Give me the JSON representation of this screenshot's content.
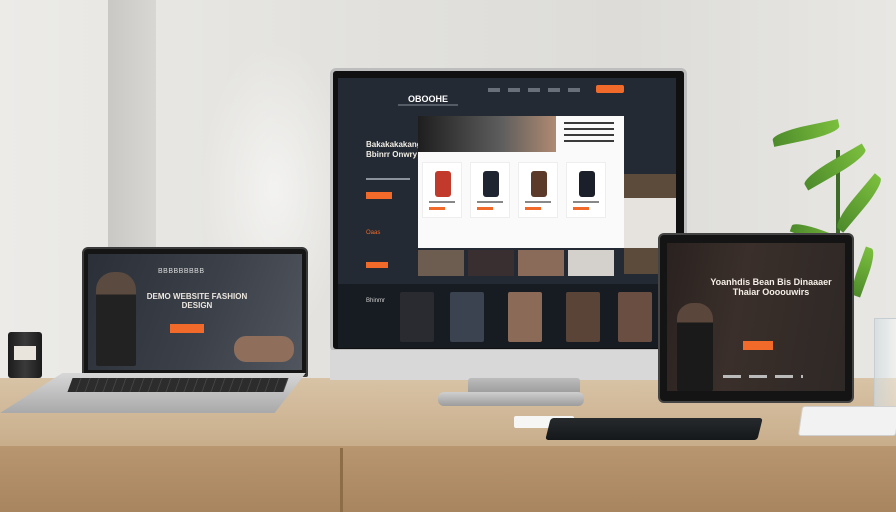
{
  "scene": {
    "description_free": true
  },
  "laptop": {
    "logo": "BBBBBBBBB",
    "headline": "DEMO WEBSITE FASHION DESIGN",
    "cta": ""
  },
  "monitor": {
    "logo": "OBOOHE",
    "hero_text": "Bakakakakang Bbinrr Onwry",
    "section_label": "Oaas",
    "strip_label": "Bhinmr",
    "products": [
      {
        "color": "#c23a2b"
      },
      {
        "color": "#1e2430"
      },
      {
        "color": "#5b3a2a"
      },
      {
        "color": "#1a1f2a"
      }
    ],
    "thumbs": [
      "#6d5d50",
      "#3a2f30",
      "#8a6b5a",
      "#d4d0cc"
    ],
    "strip_tiles": [
      "#2a2b30",
      "#3b4250",
      "#8b6a58",
      "#5a4438",
      "#4a3a33",
      "#6b4e42"
    ]
  },
  "tablet": {
    "headline": "Yoanhdis Bean Bis Dinaaaer Thaiar Oooouwirs",
    "cta": ""
  },
  "colors": {
    "accent": "#f26a2a",
    "desk": "#c8ad8a"
  }
}
